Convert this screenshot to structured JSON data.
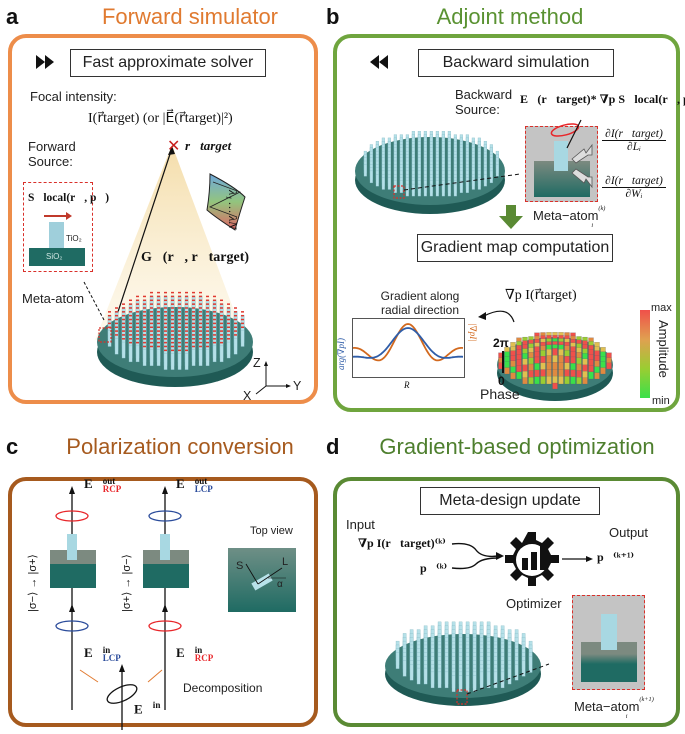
{
  "panels": {
    "a": {
      "letter": "a",
      "title": "Forward simulator",
      "color": "#ED8D4A",
      "title_color": "#E07A30",
      "step": "Fast approximate solver",
      "step_icon": "fast-forward",
      "focal_label": "Focal intensity:",
      "focal_expr": "I(r⃗target) (or |E⃗(r⃗target)|²)",
      "target_label": "r⃗target",
      "source_label_line1": "Forward",
      "source_label_line2": "Source:",
      "source_expr": "S⃗local(r⃗, p⃗)",
      "tio2": "TiO₂",
      "sio2": "SiO₂",
      "green_expr": "G⃗(r⃗, r⃗target)",
      "meta_atom_label": "Meta-atom",
      "wavelength_label": "λ₁ … λN",
      "axes": {
        "z": "Z",
        "x": "X",
        "y": "Y"
      }
    },
    "b": {
      "letter": "b",
      "title": "Adjoint method",
      "color": "#6FA53E",
      "title_color": "#5A9232",
      "step": "Backward simulation",
      "step_icon": "rewind",
      "source_label_line1": "Backward",
      "source_label_line2": "Source:",
      "source_expr": "E⃗(r⃗target)* ∇p S⃗local(r⃗, p⃗)",
      "deriv_L": {
        "num": "∂I(r⃗target)",
        "den": "∂Lᵢ"
      },
      "deriv_W": {
        "num": "∂I(r⃗target)",
        "den": "∂Wᵢ"
      },
      "meta_atom_label": "Meta−atom",
      "meta_atom_sup": "(k)",
      "meta_atom_sub": "i",
      "step2": "Gradient map computation",
      "gradient_label_line1": "Gradient along",
      "gradient_label_line2": "radial direction",
      "grad_expr": "∇p I(r⃗target)",
      "plot_xlabel": "R",
      "plot_ylabel_left": "arg(∇pI)",
      "plot_ylabel_right": "|∇pI|",
      "phase_top": "2π",
      "phase_bottom": "0",
      "phase_label": "Phase",
      "colorbar": {
        "max": "max",
        "min": "min",
        "label": "Amplitude",
        "top_color": "#F0504A",
        "bottom_color": "#3AE04A"
      }
    },
    "c": {
      "letter": "c",
      "title": "Polarization conversion",
      "color": "#A65A1E",
      "title_color": "#A65A1E",
      "out_left": {
        "base": "E⃗",
        "sup": "out",
        "sub": "RCP",
        "sub_color": "#E8262A"
      },
      "out_right": {
        "base": "E⃗",
        "sup": "out",
        "sub": "LCP",
        "sub_color": "#2B4C9B"
      },
      "in_left": {
        "base": "E⃗",
        "sup": "in",
        "sub": "LCP",
        "sub_color": "#2B4C9B"
      },
      "in_right": {
        "base": "E⃗",
        "sup": "in",
        "sub": "RCP",
        "sub_color": "#E8262A"
      },
      "ket_left": "|σ−⟩ → |σ+⟩",
      "ket_right": "|σ+⟩ → |σ−⟩",
      "top_view_label": "Top view",
      "top_view_S": "S",
      "top_view_L": "L",
      "top_view_alpha": "α",
      "decomposition_label": "Decomposition",
      "input_expr": {
        "base": "E⃗",
        "sup": "in"
      }
    },
    "d": {
      "letter": "d",
      "title": "Gradient-based optimization",
      "color": "#5A8A34",
      "title_color": "#4E7F2E",
      "step": "Meta-design update",
      "input_label": "Input",
      "output_label": "Output",
      "input_grad": "∇p I(r⃗target)⁽ᵏ⁾",
      "input_p": "p⃗⁽ᵏ⁾",
      "output_p": "p⃗⁽ᵏ⁺¹⁾",
      "optimizer_label": "Optimizer",
      "meta_atom_label": "Meta−atom",
      "meta_atom_sup": "(k+1)",
      "meta_atom_sub": "i"
    }
  },
  "colors": {
    "substrate": "#2A6A64",
    "pillar": "#A8D8E2",
    "red_marker": "#D9302A",
    "dashed_red": "#D9302A",
    "arrow_green": "#5A8A34",
    "plot_orange": "#D2691E",
    "plot_blue": "#2F5DA8"
  }
}
